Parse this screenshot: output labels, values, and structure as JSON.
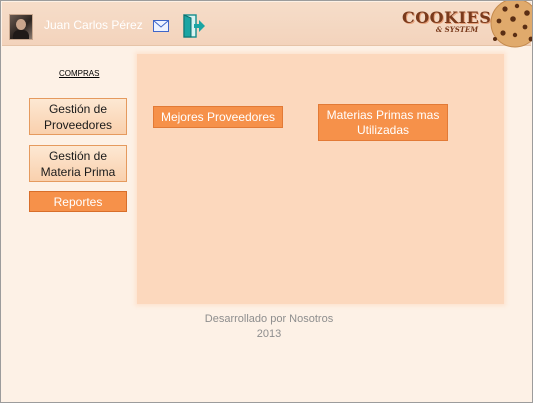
{
  "header": {
    "user_name": "Juan Carlos Pérez",
    "logo_main": "COOKIES",
    "logo_sub": "& SYSTEM"
  },
  "sidebar": {
    "section_label": "COMPRAS",
    "items": [
      {
        "label": "Gestión de Proveedores",
        "active": false
      },
      {
        "label": "Gestión de Materia Prima",
        "active": false
      },
      {
        "label": "Reportes",
        "active": true
      }
    ]
  },
  "main": {
    "reports": [
      {
        "label": "Mejores Proveedores"
      },
      {
        "label": "Materias Primas mas Utilizadas"
      }
    ]
  },
  "footer": {
    "line1": "Desarrollado por Nosotros",
    "line2": "2013"
  },
  "colors": {
    "accent": "#f6914a",
    "panel": "#fcd8bd",
    "background": "#fdf1e6",
    "header": "#f5d8c2"
  },
  "icons": [
    "user-avatar",
    "mail-icon",
    "exit-door-icon",
    "cookie-logo"
  ]
}
